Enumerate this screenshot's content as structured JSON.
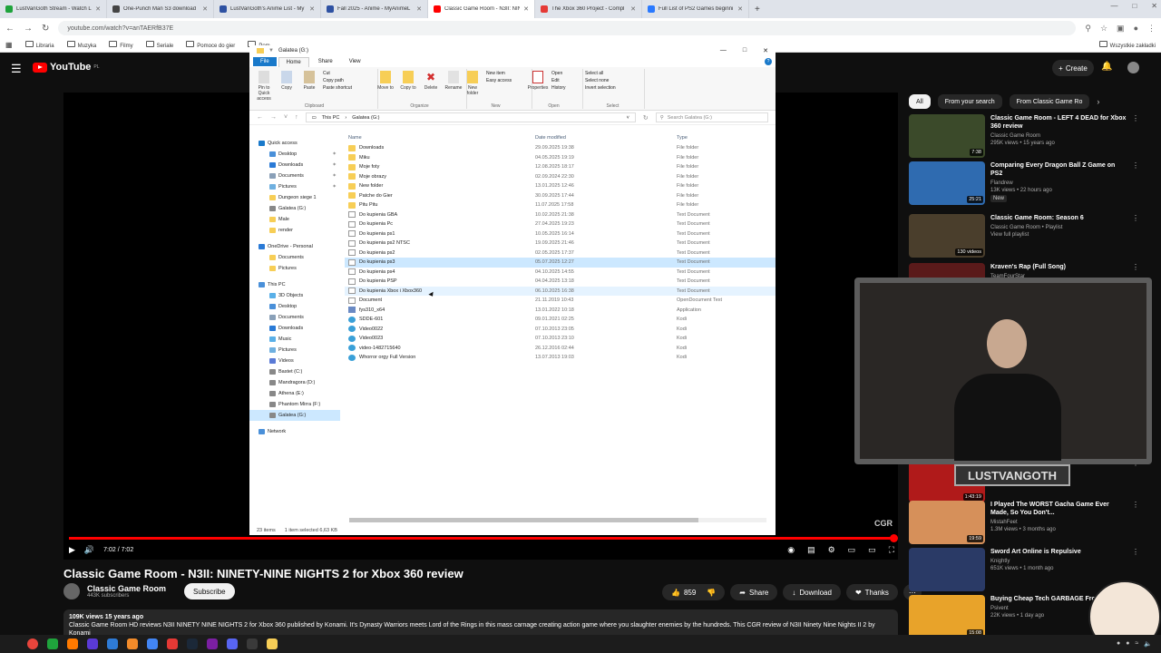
{
  "browser": {
    "tabs": [
      {
        "label": "LustVanGoth Stream - Watch L",
        "color": "#1fa33c",
        "active": false
      },
      {
        "label": "One-Punch Man S3 download",
        "color": "#444444",
        "active": false
      },
      {
        "label": "LustVanGoth's Anime List - My",
        "color": "#2e51a2",
        "active": false
      },
      {
        "label": "Fall 2025 - Anime - MyAnimeL",
        "color": "#2e51a2",
        "active": false
      },
      {
        "label": "Classic Game Room - N3II: NIN",
        "color": "#ff0000",
        "active": true
      },
      {
        "label": "The Xbox 360 Project - Compl",
        "color": "#e53935",
        "active": false
      },
      {
        "label": "Full List of PS2 Games beginni",
        "color": "#2979ff",
        "active": false
      }
    ],
    "new_tab": "+",
    "url": "youtube.com/watch?v=anTAERfB37E",
    "bookmarks": [
      "Libraria",
      "Muzyka",
      "Filmy",
      "Seriale",
      "Pomoce do gier",
      "Pom"
    ],
    "bookmarks_right": "Wszystkie zakładki"
  },
  "youtube": {
    "logo": "YouTube",
    "logo_country": "PL",
    "create": "Create",
    "chips": [
      "All",
      "From your search",
      "From Classic Game Ro"
    ],
    "player": {
      "time": "7:02 / 7:02",
      "watermark": "CGR",
      "progress": 1.0
    },
    "video_title": "Classic Game Room - N3II: NINETY-NINE NIGHTS 2 for Xbox 360 review",
    "channel": "Classic Game Room",
    "subs": "443K subscribers",
    "subscribe": "Subscribe",
    "likes": "859",
    "share": "Share",
    "download": "Download",
    "thanks": "Thanks",
    "desc_meta": "109K views  15 years ago",
    "desc_text": "Classic Game Room HD reviews N3II NINETY NINE NIGHTS 2 for Xbox 360 published by Konami. It's Dynasty Warriors meets Lord of the Rings in this mass carnage creating action game where you slaughter enemies by the hundreds. This CGR review of N3II Ninety Nine Nights II 2 by Konami",
    "recs": [
      {
        "title": "Classic Game Room - LEFT 4 DEAD for Xbox 360 review",
        "channel": "Classic Game Room",
        "meta": "295K views • 15 years ago",
        "dur": "7:38",
        "color": "#3b4a2a",
        "badge": ""
      },
      {
        "title": "Comparing Every Dragon Ball Z Game on PS2",
        "channel": "Flandrew",
        "meta": "13K views • 22 hours ago",
        "dur": "25:21",
        "color": "#2f6bb0",
        "badge": "New"
      },
      {
        "title": "Classic Game Room: Season 6",
        "channel": "Classic Game Room • Playlist",
        "meta": "View full playlist",
        "dur": "130 videos",
        "color": "#4a3e2c",
        "badge": ""
      },
      {
        "title": "Kraven's Rap (Full Song)",
        "channel": "TeamFourStar",
        "meta": "",
        "dur": "",
        "color": "#5a1a1a",
        "badge": ""
      },
      {
        "title": "",
        "channel": "",
        "meta": "",
        "dur": "1:43:19",
        "color": "#b01a1a",
        "badge": "New"
      },
      {
        "title": "I Played The WORST Gacha Game Ever Made, So You Don't...",
        "channel": "MistahFeet",
        "meta": "1.3M views • 3 months ago",
        "dur": "19:59",
        "color": "#d6905a",
        "badge": ""
      },
      {
        "title": "Sword Art Online is Repulsive",
        "channel": "Knightly",
        "meta": "651K views • 1 month ago",
        "dur": "",
        "color": "#2a3a66",
        "badge": ""
      },
      {
        "title": "Buying Cheap Tech GARBAGE From Temu...",
        "channel": "Psivent",
        "meta": "22K views • 1 day ago",
        "dur": "15:08",
        "color": "#e8a32a",
        "badge": ""
      }
    ],
    "webcam_watermark": "LUSTVANGOTH"
  },
  "explorer": {
    "title": "Galatea (G:)",
    "menu": [
      "File",
      "Home",
      "Share",
      "View"
    ],
    "ribbon": {
      "clipboard": {
        "label": "Clipboard",
        "pin": "Pin to Quick access",
        "copy": "Copy",
        "paste": "Paste",
        "cut": "Cut",
        "copy_path": "Copy path",
        "paste_shortcut": "Paste shortcut"
      },
      "organize": {
        "label": "Organize",
        "move": "Move to",
        "copy": "Copy to",
        "delete": "Delete",
        "rename": "Rename"
      },
      "new": {
        "label": "New",
        "folder": "New folder",
        "item": "New item",
        "easy": "Easy access"
      },
      "open": {
        "label": "Open",
        "properties": "Properties",
        "open": "Open",
        "edit": "Edit",
        "history": "History"
      },
      "select": {
        "label": "Select",
        "all": "Select all",
        "none": "Select none",
        "invert": "Invert selection"
      }
    },
    "breadcrumb": [
      "This PC",
      "Galatea (G:)"
    ],
    "search_placeholder": "Search Galatea (G:)",
    "columns": [
      "Name",
      "Date modified",
      "Type"
    ],
    "sidebar": [
      {
        "label": "Quick access",
        "indent": 0,
        "icon": "#1979ca",
        "pin": false
      },
      {
        "label": "Desktop",
        "indent": 1,
        "icon": "#4a90d9",
        "pin": true
      },
      {
        "label": "Downloads",
        "indent": 1,
        "icon": "#2a7ad6",
        "pin": true
      },
      {
        "label": "Documents",
        "indent": 1,
        "icon": "#8aa0b8",
        "pin": true
      },
      {
        "label": "Pictures",
        "indent": 1,
        "icon": "#6fb0e0",
        "pin": true
      },
      {
        "label": "Dungeon siege 1",
        "indent": 1,
        "icon": "#f7ce56",
        "pin": false
      },
      {
        "label": "Galatea (G:)",
        "indent": 1,
        "icon": "#888888",
        "pin": false
      },
      {
        "label": "Male",
        "indent": 1,
        "icon": "#f7ce56",
        "pin": false
      },
      {
        "label": "render",
        "indent": 1,
        "icon": "#f7ce56",
        "pin": false
      },
      {
        "label": "",
        "indent": 0,
        "icon": "",
        "pin": false
      },
      {
        "label": "OneDrive - Personal",
        "indent": 0,
        "icon": "#2a7ad6",
        "pin": false
      },
      {
        "label": "Documents",
        "indent": 1,
        "icon": "#f7ce56",
        "pin": false
      },
      {
        "label": "Pictures",
        "indent": 1,
        "icon": "#f7ce56",
        "pin": false
      },
      {
        "label": "",
        "indent": 0,
        "icon": "",
        "pin": false
      },
      {
        "label": "This PC",
        "indent": 0,
        "icon": "#4a90d9",
        "pin": false
      },
      {
        "label": "3D Objects",
        "indent": 1,
        "icon": "#5ab0e8",
        "pin": false
      },
      {
        "label": "Desktop",
        "indent": 1,
        "icon": "#4a90d9",
        "pin": false
      },
      {
        "label": "Documents",
        "indent": 1,
        "icon": "#8aa0b8",
        "pin": false
      },
      {
        "label": "Downloads",
        "indent": 1,
        "icon": "#2a7ad6",
        "pin": false
      },
      {
        "label": "Music",
        "indent": 1,
        "icon": "#5ab0e8",
        "pin": false
      },
      {
        "label": "Pictures",
        "indent": 1,
        "icon": "#6fb0e0",
        "pin": false
      },
      {
        "label": "Videos",
        "indent": 1,
        "icon": "#5a7ad6",
        "pin": false
      },
      {
        "label": "Bastet (C:)",
        "indent": 1,
        "icon": "#888888",
        "pin": false
      },
      {
        "label": "Mandragora (D:)",
        "indent": 1,
        "icon": "#888888",
        "pin": false
      },
      {
        "label": "Athena (E:)",
        "indent": 1,
        "icon": "#888888",
        "pin": false
      },
      {
        "label": "Phantom Mirra (F:)",
        "indent": 1,
        "icon": "#888888",
        "pin": false
      },
      {
        "label": "Galatea (G:)",
        "indent": 1,
        "icon": "#888888",
        "pin": false,
        "selected": true
      },
      {
        "label": "",
        "indent": 0,
        "icon": "",
        "pin": false
      },
      {
        "label": "Network",
        "indent": 0,
        "icon": "#4a90d9",
        "pin": false
      }
    ],
    "files": [
      {
        "name": "Downloads",
        "date": "29.09.2025 19:38",
        "type": "File folder",
        "kind": "folder"
      },
      {
        "name": "Miku",
        "date": "04.05.2025 19:19",
        "type": "File folder",
        "kind": "folder"
      },
      {
        "name": "Moje foty",
        "date": "12.08.2025 18:17",
        "type": "File folder",
        "kind": "folder"
      },
      {
        "name": "Moje obrazy",
        "date": "02.09.2024 22:30",
        "type": "File folder",
        "kind": "folder"
      },
      {
        "name": "New folder",
        "date": "13.01.2025 12:46",
        "type": "File folder",
        "kind": "folder"
      },
      {
        "name": "Patche do Gier",
        "date": "30.09.2025 17:44",
        "type": "File folder",
        "kind": "folder"
      },
      {
        "name": "Pitu Pitu",
        "date": "11.07.2025 17:58",
        "type": "File folder",
        "kind": "folder"
      },
      {
        "name": "Do kupienia GBA",
        "date": "10.02.2025 21:38",
        "type": "Text Document",
        "kind": "doc"
      },
      {
        "name": "Do kupienia Pc",
        "date": "27.04.2025 19:23",
        "type": "Text Document",
        "kind": "doc"
      },
      {
        "name": "Do kupienia ps1",
        "date": "10.05.2025 16:14",
        "type": "Text Document",
        "kind": "doc"
      },
      {
        "name": "Do kupienia ps2 NTSC",
        "date": "19.09.2025 21:46",
        "type": "Text Document",
        "kind": "doc"
      },
      {
        "name": "Do kupienia ps2",
        "date": "02.05.2025 17:37",
        "type": "Text Document",
        "kind": "doc"
      },
      {
        "name": "Do kupienia ps3",
        "date": "05.07.2025 12:27",
        "type": "Text Document",
        "kind": "doc",
        "selected": true
      },
      {
        "name": "Do kupienia ps4",
        "date": "04.10.2025 14:55",
        "type": "Text Document",
        "kind": "doc"
      },
      {
        "name": "Do kupienia PSP",
        "date": "04.04.2025 13:18",
        "type": "Text Document",
        "kind": "doc"
      },
      {
        "name": "Do kupienia Xbox i Xbox360",
        "date": "06.10.2025 16:38",
        "type": "Text Document",
        "kind": "doc",
        "hover": true
      },
      {
        "name": "Document",
        "date": "21.11.2019 10:43",
        "type": "OpenDocument Text",
        "kind": "doc"
      },
      {
        "name": "fys310_x64",
        "date": "13.01.2022 10:18",
        "type": "Application",
        "kind": "app"
      },
      {
        "name": "SDDE-601",
        "date": "09.01.2021 02:25",
        "type": "Kodi",
        "kind": "kodi"
      },
      {
        "name": "Video0022",
        "date": "07.10.2013 23:05",
        "type": "Kodi",
        "kind": "kodi"
      },
      {
        "name": "Video0023",
        "date": "07.10.2013 23:10",
        "type": "Kodi",
        "kind": "kodi"
      },
      {
        "name": "video-1482715640",
        "date": "26.12.2016 02:44",
        "type": "Kodi",
        "kind": "kodi"
      },
      {
        "name": "Whorror orgy Full Version",
        "date": "13.07.2013 19:03",
        "type": "Kodi",
        "kind": "kodi"
      }
    ],
    "status_count": "23 items",
    "status_selected": "1 item selected  6,63 KB"
  }
}
